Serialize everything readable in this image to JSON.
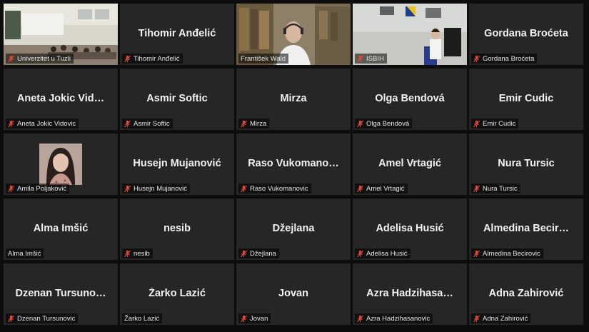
{
  "meeting": {
    "colors": {
      "tile_bg": "#262626",
      "active_speaker": "#c7dc2f",
      "muted_icon": "#e0483a"
    },
    "participants": [
      {
        "name": "Univerzitet u Tuzli",
        "display": "",
        "muted": true,
        "video": "classroom"
      },
      {
        "name": "Tihomir Anđelić",
        "display": "Tihomir Anđelić",
        "muted": true
      },
      {
        "name": "František Wald",
        "display": "",
        "muted": false,
        "video": "speaker",
        "speaking": true
      },
      {
        "name": "ISBIH",
        "display": "",
        "muted": true,
        "video": "office"
      },
      {
        "name": "Gordana Broćeta",
        "display": "Gordana Broćeta",
        "muted": true
      },
      {
        "name": "Aneta Jokic Vidovic",
        "display": "Aneta Jokic Vid…",
        "muted": true
      },
      {
        "name": "Asmir Softic",
        "display": "Asmir Softic",
        "muted": true
      },
      {
        "name": "Mirza",
        "display": "Mirza",
        "muted": true
      },
      {
        "name": "Olga Bendová",
        "display": "Olga Bendová",
        "muted": true
      },
      {
        "name": "Emir Cudic",
        "display": "Emir Cudic",
        "muted": true
      },
      {
        "name": "Amila Poljaković",
        "display": "",
        "muted": true,
        "video": "avatar"
      },
      {
        "name": "Husejn Mujanović",
        "display": "Husejn Mujanović",
        "muted": true
      },
      {
        "name": "Raso Vukomanovic",
        "display": "Raso  Vukomano…",
        "muted": true
      },
      {
        "name": "Amel Vrtagić",
        "display": "Amel Vrtagić",
        "muted": true
      },
      {
        "name": "Nura Tursic",
        "display": "Nura Tursic",
        "muted": true
      },
      {
        "name": "Alma Imšić",
        "display": "Alma Imšić",
        "muted": false
      },
      {
        "name": "nesib",
        "display": "nesib",
        "muted": true
      },
      {
        "name": "Džejlana",
        "display": "Džejlana",
        "muted": true
      },
      {
        "name": "Adelisa Husić",
        "display": "Adelisa Husić",
        "muted": true
      },
      {
        "name": "Almedina Becirovic",
        "display": "Almedina  Becir…",
        "muted": true
      },
      {
        "name": "Dzenan Tursunovic",
        "display": "Dzenan Tursuno…",
        "muted": true
      },
      {
        "name": "Žarko Lazić",
        "display": "Žarko Lazić",
        "muted": false
      },
      {
        "name": "Jovan",
        "display": "Jovan",
        "muted": true
      },
      {
        "name": "Azra Hadzihasanovic",
        "display": "Azra  Hadzihasa…",
        "muted": true
      },
      {
        "name": "Adna Zahirović",
        "display": "Adna Zahirović",
        "muted": true
      }
    ]
  }
}
